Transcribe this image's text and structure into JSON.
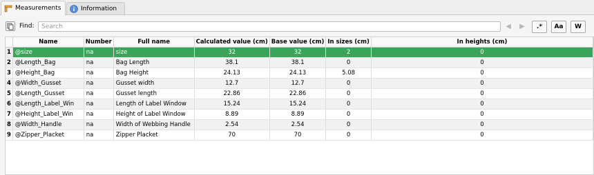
{
  "tabs": [
    {
      "label": "Measurements",
      "icon": "ruler-icon",
      "active": true
    },
    {
      "label": "Information",
      "icon": "info-icon",
      "active": false
    }
  ],
  "findbar": {
    "find_label": "Find:",
    "search_placeholder": "Search",
    "search_value": "",
    "regex_label": ".*",
    "case_label": "Aa",
    "word_label": "W"
  },
  "table": {
    "columns": [
      "Name",
      "Number",
      "Full name",
      "Calculated value (cm)",
      "Base value (cm)",
      "In sizes (cm)",
      "In heights (cm)"
    ],
    "rows": [
      {
        "n": "1",
        "name": "@size",
        "number": "na",
        "full": "size",
        "calc": "32",
        "base": "32",
        "sizes": "2",
        "heights": "0"
      },
      {
        "n": "2",
        "name": "@Length_Bag",
        "number": "na",
        "full": "Bag Length",
        "calc": "38.1",
        "base": "38.1",
        "sizes": "0",
        "heights": "0"
      },
      {
        "n": "3",
        "name": "@Height_Bag",
        "number": "na",
        "full": "Bag Height",
        "calc": "24.13",
        "base": "24.13",
        "sizes": "5.08",
        "heights": "0"
      },
      {
        "n": "4",
        "name": "@Width_Gusset",
        "number": "na",
        "full": "Gusset width",
        "calc": "12.7",
        "base": "12.7",
        "sizes": "0",
        "heights": "0"
      },
      {
        "n": "5",
        "name": "@Length_Gusset",
        "number": "na",
        "full": "Gusset length",
        "calc": "22.86",
        "base": "22.86",
        "sizes": "0",
        "heights": "0"
      },
      {
        "n": "6",
        "name": "@Length_Label_Win",
        "number": "na",
        "full": "Length of Label Window",
        "calc": "15.24",
        "base": "15.24",
        "sizes": "0",
        "heights": "0"
      },
      {
        "n": "7",
        "name": "@Height_Label_Win",
        "number": "na",
        "full": "Height of Label Window",
        "calc": "8.89",
        "base": "8.89",
        "sizes": "0",
        "heights": "0"
      },
      {
        "n": "8",
        "name": "@Width_Handle",
        "number": "na",
        "full": "Width of Webbing Handle",
        "calc": "2.54",
        "base": "2.54",
        "sizes": "0",
        "heights": "0"
      },
      {
        "n": "9",
        "name": "@Zipper_Placket",
        "number": "na",
        "full": "Zipper Placket",
        "calc": "70",
        "base": "70",
        "sizes": "0",
        "heights": "0"
      }
    ],
    "selected_row": 0
  },
  "colors": {
    "selection": "#3aa55a",
    "alt_row": "#f1f1f1"
  }
}
